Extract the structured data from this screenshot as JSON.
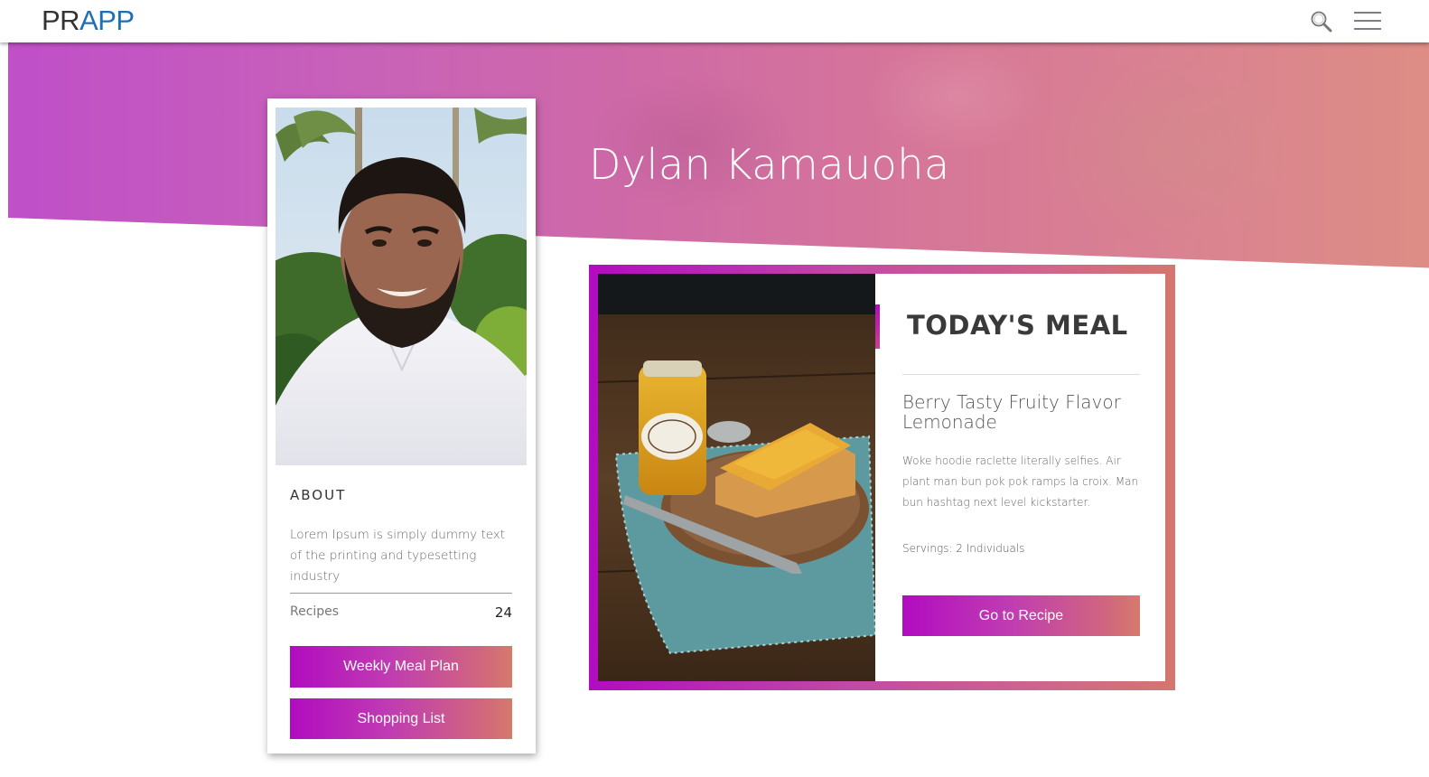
{
  "navbar": {
    "brand_part1": "PR",
    "brand_part2": "APP",
    "search_icon": "search-icon",
    "menu_icon": "hamburger-menu-icon"
  },
  "hero": {
    "name": "Dylan Kamauoha"
  },
  "profile": {
    "photo": "profile-photo",
    "about_heading": "ABOUT",
    "about_text": "Lorem Ipsum is simply dummy text of the printing and typesetting industry",
    "stat_label": "Recipes",
    "stat_value": "24",
    "weekly_button": "Weekly Meal Plan",
    "shopping_button": "Shopping List"
  },
  "meal": {
    "heading": "TODAY'S MEAL",
    "title": "Berry Tasty Fruity Flavor Lemonade",
    "description": "Woke hoodie raclette literally selfies. Air plant man bun pok pok ramps la croix. Man bun hashtag next level kickstarter.",
    "servings": "Servings: 2 Individuals",
    "button": "Go to Recipe",
    "photo": "meal-photo"
  },
  "colors": {
    "brand_dark": "#333333",
    "brand_blue": "#1f6fb5",
    "gradient_start": "#b10cc0",
    "gradient_end": "#d57a6c",
    "hero_start": "#c04fc8",
    "hero_end": "#dd8d85"
  }
}
